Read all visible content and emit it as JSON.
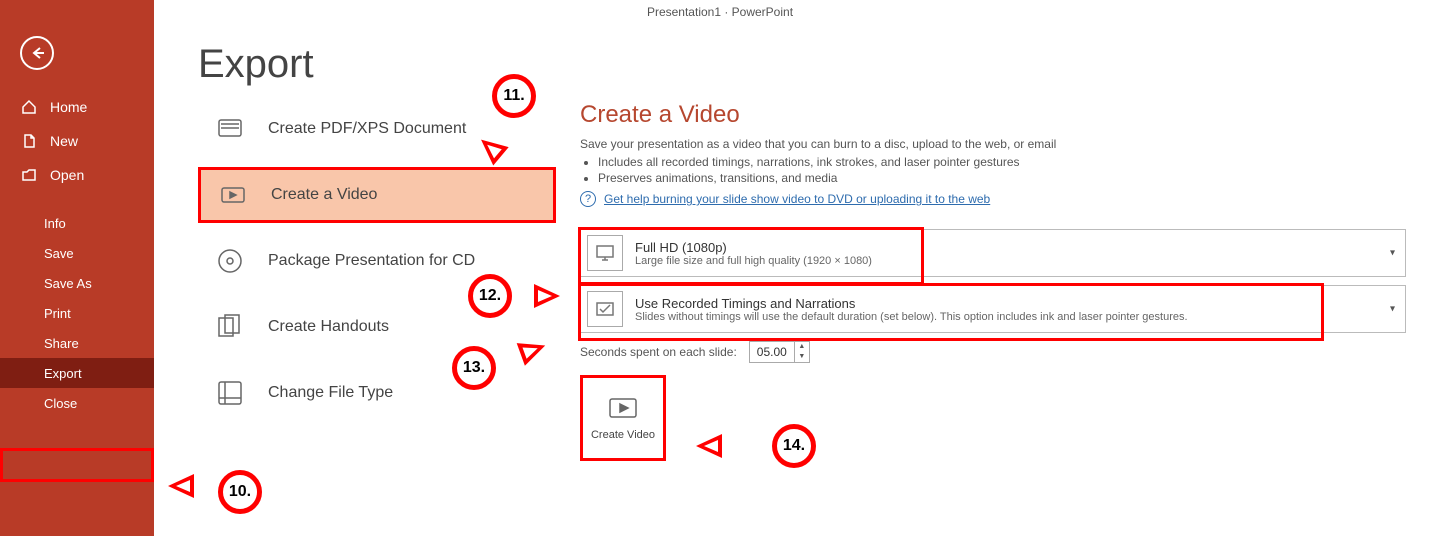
{
  "titlebar": {
    "text": "Presentation1 · PowerPoint"
  },
  "sidebar": {
    "back": "Back",
    "items": [
      {
        "label": "Home"
      },
      {
        "label": "New"
      },
      {
        "label": "Open"
      }
    ],
    "items2": [
      {
        "label": "Info"
      },
      {
        "label": "Save"
      },
      {
        "label": "Save As"
      },
      {
        "label": "Print"
      },
      {
        "label": "Share"
      },
      {
        "label": "Export",
        "active": true
      },
      {
        "label": "Close"
      }
    ]
  },
  "page": {
    "title": "Export"
  },
  "options": [
    {
      "label": "Create PDF/XPS Document"
    },
    {
      "label": "Create a Video",
      "selected": true
    },
    {
      "label": "Package Presentation for CD"
    },
    {
      "label": "Create Handouts"
    },
    {
      "label": "Change File Type"
    }
  ],
  "video": {
    "title": "Create a Video",
    "desc": "Save your presentation as a video that you can burn to a disc, upload to the web, or email",
    "bullet1": "Includes all recorded timings, narrations, ink strokes, and laser pointer gestures",
    "bullet2": "Preserves animations, transitions, and media",
    "help": "Get help burning your slide show video to DVD or uploading it to the web",
    "quality": {
      "title": "Full HD (1080p)",
      "sub": "Large file size and full high quality (1920 × 1080)"
    },
    "timings": {
      "title": "Use Recorded Timings and Narrations",
      "sub": "Slides without timings will use the default duration (set below). This option includes ink and laser pointer gestures."
    },
    "seconds": {
      "label": "Seconds spent on each slide:",
      "value": "05.00"
    },
    "createBtn": "Create Video"
  },
  "callouts": {
    "c10": "10.",
    "c11": "11.",
    "c12": "12.",
    "c13": "13.",
    "c14": "14."
  }
}
